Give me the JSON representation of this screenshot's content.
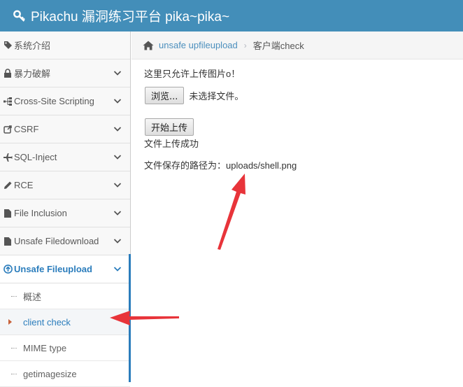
{
  "header": {
    "title": "Pikachu 漏洞练习平台 pika~pika~",
    "icon": "key-icon"
  },
  "sidebar": {
    "items": [
      {
        "label": "系统介绍",
        "icon": "tag-icon"
      },
      {
        "label": "暴力破解",
        "icon": "lock-icon"
      },
      {
        "label": "Cross-Site Scripting",
        "icon": "sitemap-icon"
      },
      {
        "label": "CSRF",
        "icon": "external-link-icon"
      },
      {
        "label": "SQL-Inject",
        "icon": "plane-icon"
      },
      {
        "label": "RCE",
        "icon": "pencil-icon"
      },
      {
        "label": "File Inclusion",
        "icon": "file-icon"
      },
      {
        "label": "Unsafe Filedownload",
        "icon": "file-icon"
      },
      {
        "label": "Unsafe Fileupload",
        "icon": "upload-icon"
      }
    ],
    "subitems": [
      {
        "label": "概述"
      },
      {
        "label": "client check"
      },
      {
        "label": "MIME type"
      },
      {
        "label": "getimagesize"
      }
    ]
  },
  "breadcrumb": {
    "home_icon": "home-icon",
    "link": "unsafe upfileupload",
    "current": "客户端check"
  },
  "main": {
    "intro": "这里只允许上传图片o！",
    "browse_button": "浏览...",
    "no_file": "未选择文件。",
    "upload_button": "开始上传",
    "success": "文件上传成功",
    "path_label": "文件保存的路径为：",
    "path_value": "uploads/shell.png"
  },
  "colors": {
    "header": "#438eb9",
    "link": "#4c8fbd",
    "active": "#2b7dbc",
    "arrow": "#e8343a"
  }
}
